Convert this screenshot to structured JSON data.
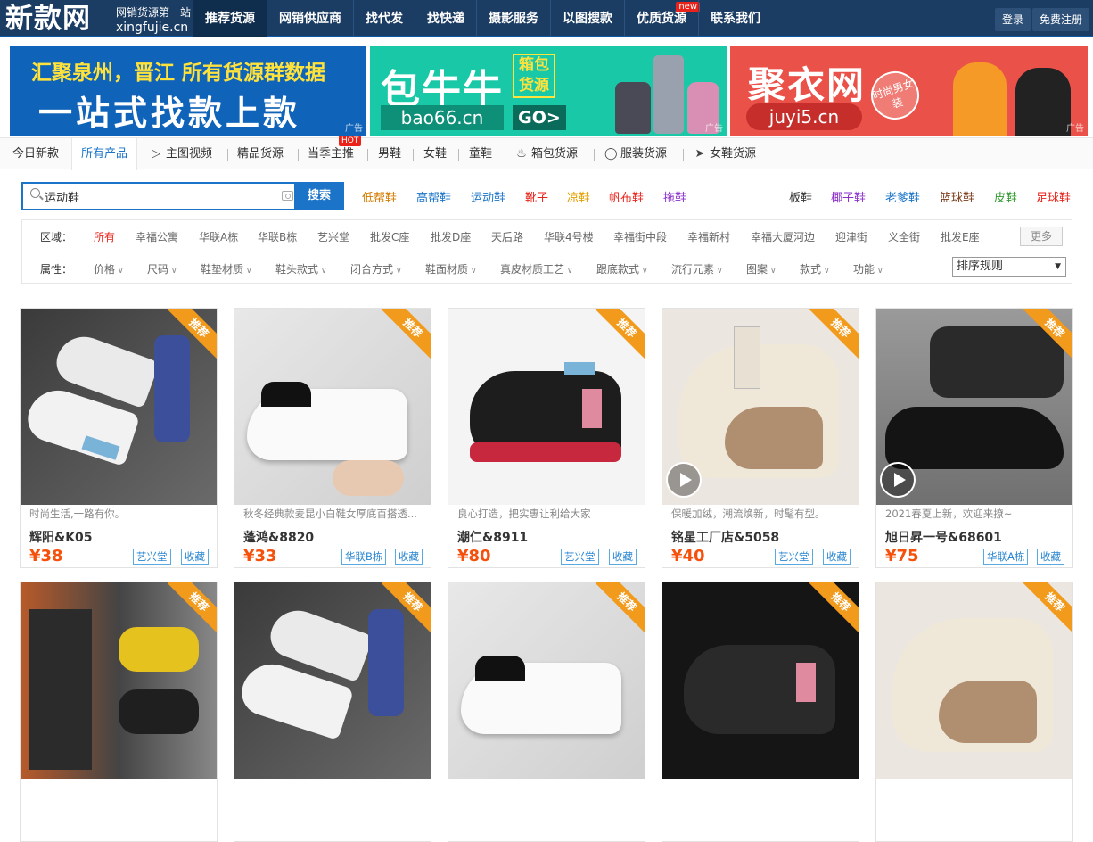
{
  "header": {
    "logo_text": "新款网",
    "logo_slogan": "网销货源第一站",
    "logo_domain": "xingfujie.cn",
    "nav": [
      {
        "label": "推荐货源",
        "active": true
      },
      {
        "label": "网销供应商"
      },
      {
        "label": "找代发"
      },
      {
        "label": "找快递"
      },
      {
        "label": "摄影服务"
      },
      {
        "label": "以图搜款"
      },
      {
        "label": "优质货源",
        "badge": "new"
      },
      {
        "label": "联系我们"
      }
    ],
    "login_label": "登录",
    "register_label": "免费注册"
  },
  "banners": {
    "banner1": {
      "line1": "汇聚泉州，晋江 所有货源群数据",
      "line2": "一站式找款上款"
    },
    "banner2": {
      "name": "包牛牛",
      "box": "箱包货源",
      "url": "bao66.cn",
      "go": "GO>"
    },
    "banner3": {
      "name": "聚衣网",
      "stamp": "时尚男女装",
      "url": "juyi5.cn"
    },
    "ad_label": "广告"
  },
  "category_tabs": {
    "items": [
      "今日新款",
      "所有产品",
      "主图视频",
      "精品货源",
      "当季主推",
      "男鞋",
      "女鞋",
      "童鞋",
      "箱包货源",
      "服装货源",
      "女鞋货源"
    ],
    "hot_badge": "HOT",
    "active_index": 1
  },
  "search": {
    "value": "运动鞋",
    "button_label": "搜索",
    "keywords_left": [
      {
        "label": "低帮鞋",
        "color": "#d37b00"
      },
      {
        "label": "高帮鞋",
        "color": "#1b74c8"
      },
      {
        "label": "运动鞋",
        "color": "#1b74c8"
      },
      {
        "label": "靴子",
        "color": "#e9231a"
      },
      {
        "label": "凉鞋",
        "color": "#e5a000"
      },
      {
        "label": "帆布鞋",
        "color": "#e9231a"
      },
      {
        "label": "拖鞋",
        "color": "#8b2fc9"
      }
    ],
    "keywords_right": [
      {
        "label": "板鞋",
        "color": "#333333"
      },
      {
        "label": "椰子鞋",
        "color": "#8b2fc9"
      },
      {
        "label": "老爹鞋",
        "color": "#1b74c8"
      },
      {
        "label": "篮球鞋",
        "color": "#7a3b1a"
      },
      {
        "label": "皮鞋",
        "color": "#2e9a2e"
      },
      {
        "label": "足球鞋",
        "color": "#e9231a"
      }
    ]
  },
  "filters": {
    "region_label": "区域：",
    "regions": [
      "所有",
      "幸福公寓",
      "华联A栋",
      "华联B栋",
      "艺兴堂",
      "批发C座",
      "批发D座",
      "天后路",
      "华联4号楼",
      "幸福街中段",
      "幸福新村",
      "幸福大厦河边",
      "迎津街",
      "义全街",
      "批发E座"
    ],
    "more_label": "更多",
    "attr_label": "属性：",
    "attributes": [
      "价格",
      "尺码",
      "鞋垫材质",
      "鞋头款式",
      "闭合方式",
      "鞋面材质",
      "真皮材质工艺",
      "跟底款式",
      "流行元素",
      "图案",
      "款式",
      "功能"
    ],
    "sort_label": "排序规则"
  },
  "products": [
    {
      "desc": "时尚生活,一路有你。",
      "shop": "辉阳&K05",
      "price": "¥38",
      "area": "艺兴堂",
      "fav": "收藏",
      "ribbon": "推荐",
      "video": false
    },
    {
      "desc": "秋冬经典款麦昆小白鞋女厚底百搭透...",
      "shop": "蓬鸿&8820",
      "price": "¥33",
      "area": "华联B栋",
      "fav": "收藏",
      "ribbon": "推荐",
      "video": false
    },
    {
      "desc": "良心打造，把实惠让利给大家",
      "shop": "潮仁&8911",
      "price": "¥80",
      "area": "艺兴堂",
      "fav": "收藏",
      "ribbon": "推荐",
      "video": false
    },
    {
      "desc": "保暖加绒，潮流焕新，时髦有型。",
      "shop": "铭星工厂店&5058",
      "price": "¥40",
      "area": "艺兴堂",
      "fav": "收藏",
      "ribbon": "推荐",
      "video": true
    },
    {
      "desc": "2021春夏上新，欢迎来撩~",
      "shop": "旭日昇一号&68601",
      "price": "¥75",
      "area": "华联A栋",
      "fav": "收藏",
      "ribbon": "推荐",
      "video": true
    },
    {
      "ribbon": "推荐"
    },
    {
      "ribbon": "推荐"
    },
    {
      "ribbon": "推荐"
    },
    {
      "ribbon": "推荐"
    },
    {
      "ribbon": "推荐"
    }
  ]
}
